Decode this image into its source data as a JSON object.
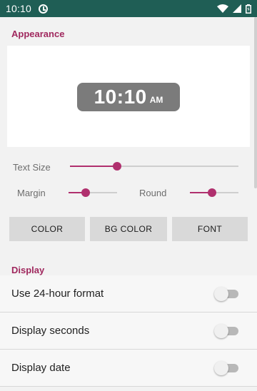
{
  "status_bar": {
    "time": "10:10",
    "icons": [
      "clock-icon",
      "wifi-icon",
      "signal-icon",
      "battery-icon"
    ]
  },
  "appearance": {
    "title": "Appearance",
    "preview_time": "10:10",
    "preview_ampm": "AM",
    "text_size_label": "Text Size",
    "text_size_value": 0.28,
    "margin_label": "Margin",
    "margin_value": 0.35,
    "round_label": "Round",
    "round_value": 0.45,
    "buttons": {
      "color": "COLOR",
      "bg_color": "BG COLOR",
      "font": "FONT"
    }
  },
  "display": {
    "title": "Display",
    "settings": [
      {
        "label": "Use 24-hour format",
        "enabled": false
      },
      {
        "label": "Display seconds",
        "enabled": false
      },
      {
        "label": "Display date",
        "enabled": false
      }
    ]
  },
  "colors": {
    "status_bar": "#1f5e55",
    "accent": "#b0306e",
    "section_title": "#a0285e",
    "clock_pill": "#7b7b7b"
  }
}
